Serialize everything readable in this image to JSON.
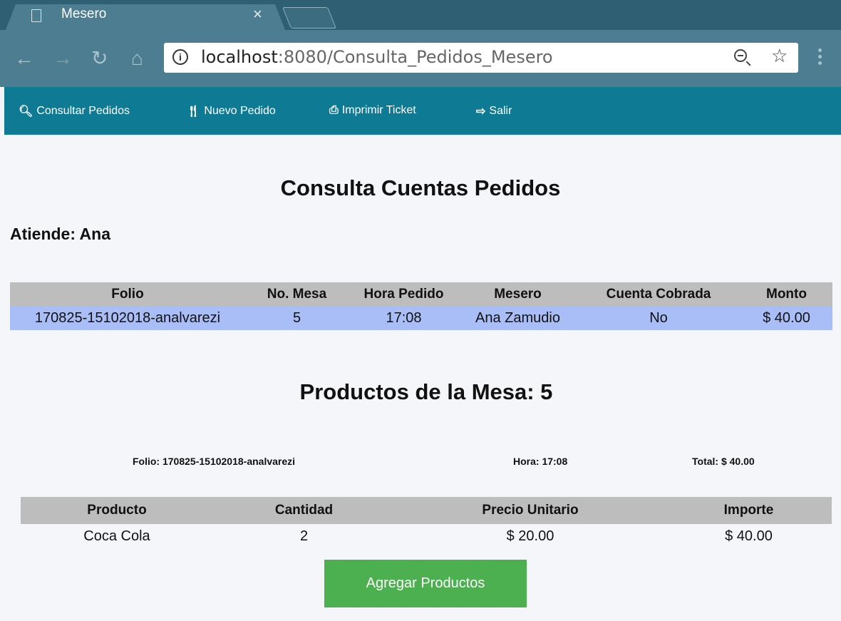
{
  "browser": {
    "tab_title": "Mesero",
    "tab_close": "×",
    "url_host": "localhost",
    "url_rest": ":8080/Consulta_Pedidos_Mesero"
  },
  "nav": {
    "items": [
      {
        "label": "Consultar Pedidos",
        "icon": "search-icon"
      },
      {
        "label": "Nuevo Pedido",
        "icon": "utensils-icon"
      },
      {
        "label": "Imprimir Ticket",
        "icon": "print-icon"
      },
      {
        "label": "Salir",
        "icon": "logout-icon"
      }
    ]
  },
  "page": {
    "title": "Consulta Cuentas Pedidos",
    "atiende": "Atiende: Ana"
  },
  "orders": {
    "headers": [
      "Folio",
      "No. Mesa",
      "Hora Pedido",
      "Mesero",
      "Cuenta Cobrada",
      "Monto"
    ],
    "rows": [
      [
        "170825-15102018-analvarezi",
        "5",
        "17:08",
        "Ana Zamudio",
        "No",
        "$ 40.00"
      ]
    ]
  },
  "products_section": {
    "title": "Productos de la Mesa: 5",
    "folio": "Folio: 170825-15102018-analvarezi",
    "hora": "Hora: 17:08",
    "total": "Total: $ 40.00"
  },
  "products": {
    "headers": [
      "Producto",
      "Cantidad",
      "Precio Unitario",
      "Importe"
    ],
    "rows": [
      [
        "Coca Cola",
        "2",
        "$ 20.00",
        "$ 40.00"
      ]
    ]
  },
  "add_button": "Agregar Productos",
  "colors": {
    "nav_bg": "#0f7a93",
    "header_bg": "#bdbdbd",
    "row_highlight": "#a9bdf7",
    "button_bg": "#4caf50"
  }
}
